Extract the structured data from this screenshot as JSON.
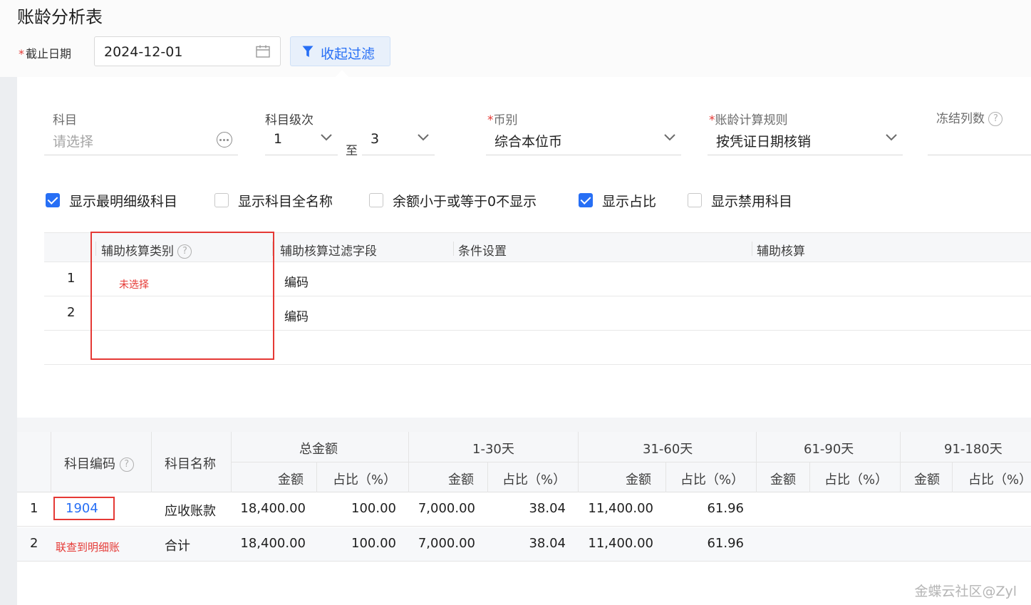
{
  "title": "账龄分析表",
  "header": {
    "date_label": "截止日期",
    "date_required": "*",
    "date_value": "2024-12-01",
    "filter_button": "收起过滤"
  },
  "filters": {
    "subject_label": "科目",
    "subject_placeholder": "请选择",
    "level_label": "科目级次",
    "level_from": "1",
    "level_to_sep": "至",
    "level_to": "3",
    "currency_label": "币别",
    "currency_value": "综合本位币",
    "rule_label": "账龄计算规则",
    "rule_value": "按凭证日期核销",
    "freeze_label": "冻结列数",
    "required_mark": "*"
  },
  "checkboxes": [
    {
      "label": "显示最明细级科目",
      "checked": true
    },
    {
      "label": "显示科目全名称",
      "checked": false
    },
    {
      "label": "余额小于或等于0不显示",
      "checked": false
    },
    {
      "label": "显示占比",
      "checked": true
    },
    {
      "label": "显示禁用科目",
      "checked": false
    }
  ],
  "aux_grid": {
    "headers": [
      "辅助核算类别",
      "辅助核算过滤字段",
      "条件设置",
      "辅助核算"
    ],
    "rows": [
      {
        "index": "1",
        "filter_field": "编码"
      },
      {
        "index": "2",
        "filter_field": "编码"
      }
    ]
  },
  "annotations": {
    "unselected": "未选择",
    "link_note": "联查到明细账"
  },
  "result_table": {
    "headers": {
      "code": "科目编码",
      "name": "科目名称",
      "groups": [
        "总金额",
        "1-30天",
        "31-60天",
        "61-90天",
        "91-180天"
      ],
      "amount": "金额",
      "ratio": "占比（%）"
    },
    "rows": [
      {
        "index": "1",
        "code": "1904",
        "name": "应收账款",
        "total": "18,400.00",
        "total_ratio": "100.00",
        "d30": "7,000.00",
        "d30_ratio": "38.04",
        "d60": "11,400.00",
        "d60_ratio": "61.96"
      },
      {
        "index": "2",
        "code": "",
        "name": "合计",
        "total": "18,400.00",
        "total_ratio": "100.00",
        "d30": "7,000.00",
        "d30_ratio": "38.04",
        "d60": "11,400.00",
        "d60_ratio": "61.96"
      }
    ]
  },
  "watermark": "金蝶云社区@Zyl",
  "colors": {
    "accent": "#276ff5",
    "annotation": "#e53935"
  }
}
